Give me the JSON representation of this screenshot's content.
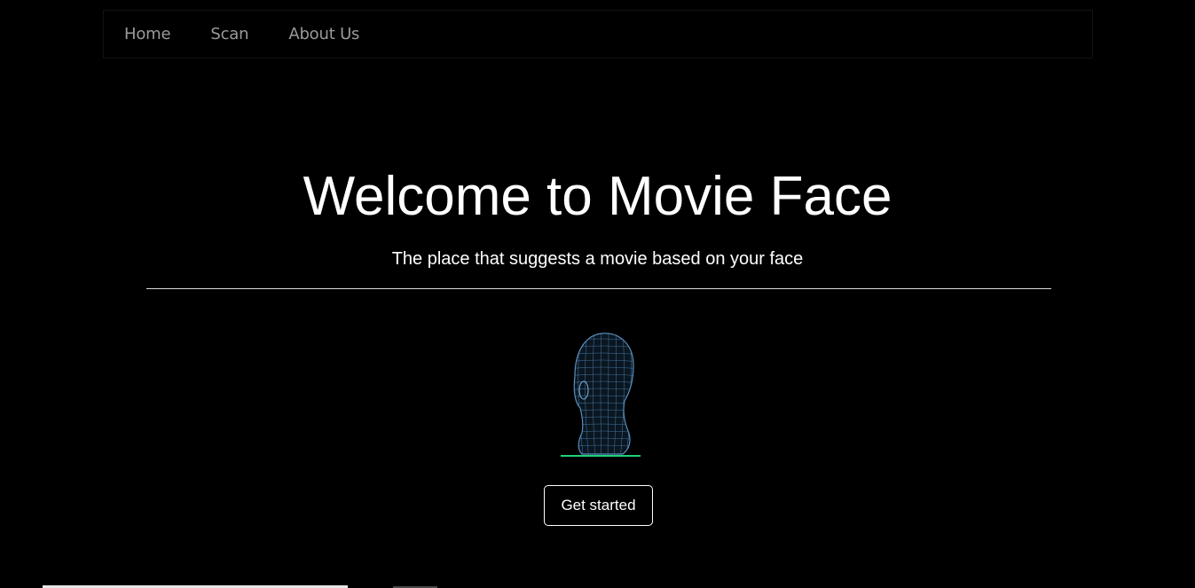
{
  "nav": {
    "items": [
      {
        "label": "Home"
      },
      {
        "label": "Scan"
      },
      {
        "label": "About Us"
      }
    ]
  },
  "hero": {
    "title": "Welcome to Movie Face",
    "subtitle": "The place that suggests a movie based on your face",
    "cta_label": "Get started"
  },
  "colors": {
    "background": "#000000",
    "text": "#ffffff",
    "nav_text": "#9a9a9a",
    "wireframe": "#5a8fbf",
    "scan_line": "#1fd17a"
  },
  "icons": {
    "hero_image": "wireframe-head-icon"
  }
}
